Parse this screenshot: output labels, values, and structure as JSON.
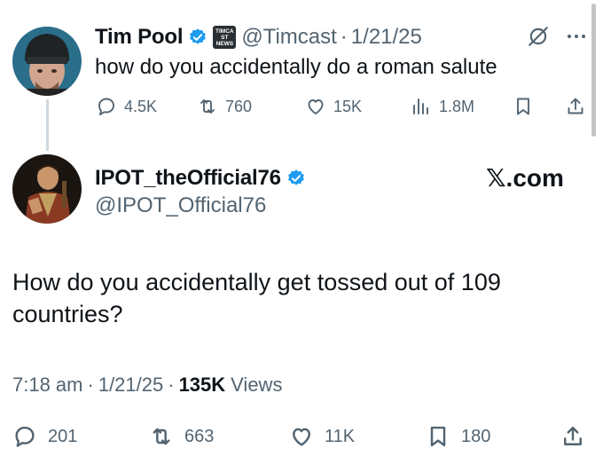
{
  "quoted_tweet": {
    "author_name": "Tim Pool",
    "affiliate_badge": "TIMCAST NEWS",
    "handle": "@Timcast",
    "separator": "·",
    "date": "1/21/25",
    "text": "how do you accidentally do a roman salute",
    "actions": {
      "replies": "4.5K",
      "reposts": "760",
      "likes": "15K",
      "views": "1.8M"
    }
  },
  "reply_tweet": {
    "author_name": "IPOT_theOfficial76",
    "handle": "@IPOT_Official76",
    "watermark": "𝕏.com",
    "text": "How do you accidentally get tossed out of 109 countries?",
    "time": "7:18 am",
    "separator": "·",
    "date": "1/21/25",
    "views_count": "135K",
    "views_label": "Views",
    "actions": {
      "replies": "201",
      "reposts": "663",
      "likes": "11K",
      "bookmarks": "180"
    }
  },
  "colors": {
    "verified_blue": "#1d9bf0",
    "text_primary": "#0f1419",
    "text_secondary": "#536471",
    "thread_line": "#cfd9de"
  },
  "icons": [
    "verified-badge-icon",
    "grok-icon",
    "more-icon",
    "reply-icon",
    "repost-icon",
    "like-icon",
    "views-icon",
    "bookmark-icon",
    "share-icon"
  ]
}
